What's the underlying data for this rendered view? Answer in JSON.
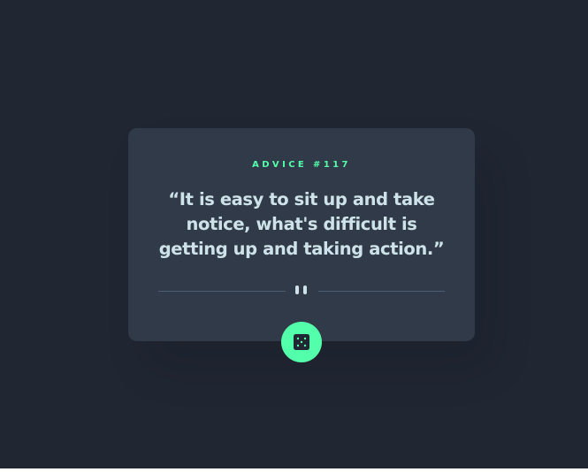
{
  "advice": {
    "id_label": "ADVICE #117",
    "quote": "“It is easy to sit up and take notice, what's difficult is getting up and taking action.”"
  },
  "icons": {
    "divider": "pause-icon",
    "button": "dice-icon"
  },
  "colors": {
    "background": "#202632",
    "card": "#313a48",
    "accent": "#53ffaa",
    "text": "#cee3e9",
    "divider": "#4f5d74"
  }
}
